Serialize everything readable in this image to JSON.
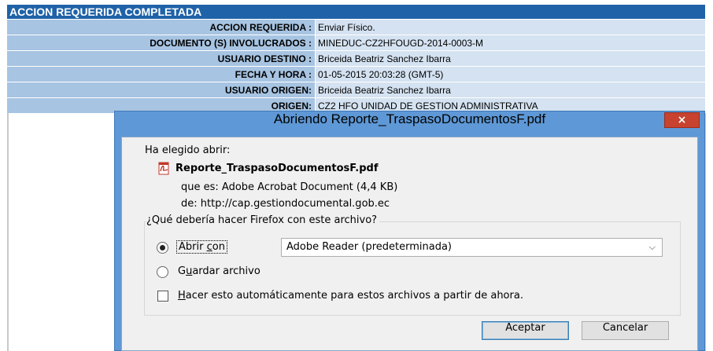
{
  "info_table": {
    "header": "ACCION REQUERIDA COMPLETADA",
    "rows": [
      {
        "label": "ACCION REQUERIDA :",
        "value": "Enviar Físico."
      },
      {
        "label": "DOCUMENTO (S) INVOLUCRADOS :",
        "value": "MINEDUC-CZ2HFOUGD-2014-0003-M"
      },
      {
        "label": "USUARIO DESTINO :",
        "value": "Briceida Beatriz Sanchez Ibarra"
      },
      {
        "label": "FECHA Y HORA :",
        "value": "01-05-2015 20:03:28 (GMT-5)"
      },
      {
        "label": "USUARIO ORIGEN:",
        "value": "Briceida Beatriz Sanchez Ibarra"
      },
      {
        "label": "ORIGEN:",
        "value": "CZ2 HFO UNIDAD DE GESTION ADMINISTRATIVA"
      }
    ]
  },
  "dialog": {
    "title": "Abriendo Reporte_TraspasoDocumentosF.pdf",
    "close_glyph": "×",
    "chosen_label": "Ha elegido abrir:",
    "file_icon": "pdf-icon",
    "file_name": "Reporte_TraspasoDocumentosF.pdf",
    "type_line": "que es:  Adobe Acrobat Document (4,4 KB)",
    "from_line": "de:  http://cap.gestiondocumental.gob.ec",
    "question": "¿Qué debería hacer Firefox con este archivo?",
    "open_with": {
      "pre": "Abrir ",
      "accel": "c",
      "post": "on",
      "selected": true
    },
    "app_select": {
      "value": "Adobe Reader  (predeterminada)"
    },
    "save_file": {
      "pre": "G",
      "accel": "u",
      "post": "ardar archivo",
      "selected": false
    },
    "auto": {
      "pre": "",
      "accel": "H",
      "post": "acer esto automáticamente para estos archivos a partir de ahora.",
      "checked": false
    },
    "ok_label": "Aceptar",
    "cancel_label": "Cancelar"
  },
  "colors": {
    "header_bg": "#1f62a8",
    "label_bg": "#a7c4e2",
    "value_bg": "#d4e2f1",
    "dialog_frame": "#5e98d6",
    "close_bg": "#c7432f"
  }
}
